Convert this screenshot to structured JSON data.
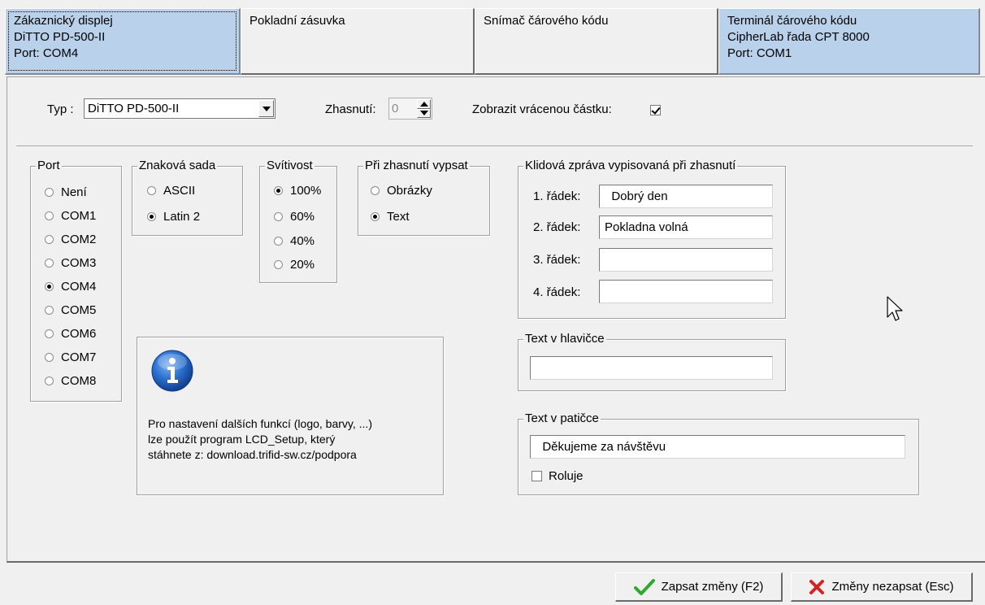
{
  "tabs": [
    {
      "lines": [
        "Zákaznický displej",
        "DiTTO PD-500-II",
        "Port: COM4"
      ]
    },
    {
      "lines": [
        "Pokladní zásuvka"
      ]
    },
    {
      "lines": [
        "Snímač čárového kódu"
      ]
    },
    {
      "lines": [
        "Terminál čárového kódu",
        "CipherLab řada CPT 8000",
        "Port: COM1"
      ]
    }
  ],
  "top_row": {
    "typ_label": "Typ :",
    "typ_value": "DiTTO PD-500-II",
    "zhasnuti_label": "Zhasnutí:",
    "zhasnuti_value": "0",
    "zobrazit_label": "Zobrazit vrácenou částku:",
    "zobrazit_checked": true
  },
  "port": {
    "title": "Port",
    "options": [
      "Není",
      "COM1",
      "COM2",
      "COM3",
      "COM4",
      "COM5",
      "COM6",
      "COM7",
      "COM8"
    ],
    "selected": "COM4"
  },
  "znakova_sada": {
    "title": "Znaková sada",
    "options": [
      "ASCII",
      "Latin 2"
    ],
    "selected": "Latin 2"
  },
  "svitivost": {
    "title": "Svítivost",
    "options": [
      "100%",
      "60%",
      "40%",
      "20%"
    ],
    "selected": "100%"
  },
  "pri_zhasnuti": {
    "title": "Při zhasnutí vypsat",
    "options": [
      "Obrázky",
      "Text"
    ],
    "selected": "Text"
  },
  "klidova": {
    "title": "Klidová zpráva vypisovaná při zhasnutí",
    "rows": [
      {
        "label": "1. řádek:",
        "value": "  Dobrý den"
      },
      {
        "label": "2. řádek:",
        "value": "Pokladna volná"
      },
      {
        "label": "3. řádek:",
        "value": ""
      },
      {
        "label": "4. řádek:",
        "value": ""
      }
    ]
  },
  "hlavicka": {
    "title": "Text v hlavičce",
    "value": ""
  },
  "paticka": {
    "title": "Text v patičce",
    "value": "  Děkujeme za návštěvu",
    "roluje_label": "Roluje",
    "roluje_checked": false
  },
  "info": {
    "lines": [
      "Pro nastavení dalších funkcí (logo, barvy, ...)",
      "lze použít program LCD_Setup, který",
      "stáhnete z: download.trifid-sw.cz/podpora"
    ]
  },
  "buttons": {
    "save": "Zapsat změny (F2)",
    "cancel": "Změny nezapsat (Esc)"
  },
  "colors": {
    "tab_selected": "#b9d1ea",
    "info_blue": "#1f63c6",
    "save_check": "#2fa82f",
    "cancel_x": "#d42323"
  }
}
